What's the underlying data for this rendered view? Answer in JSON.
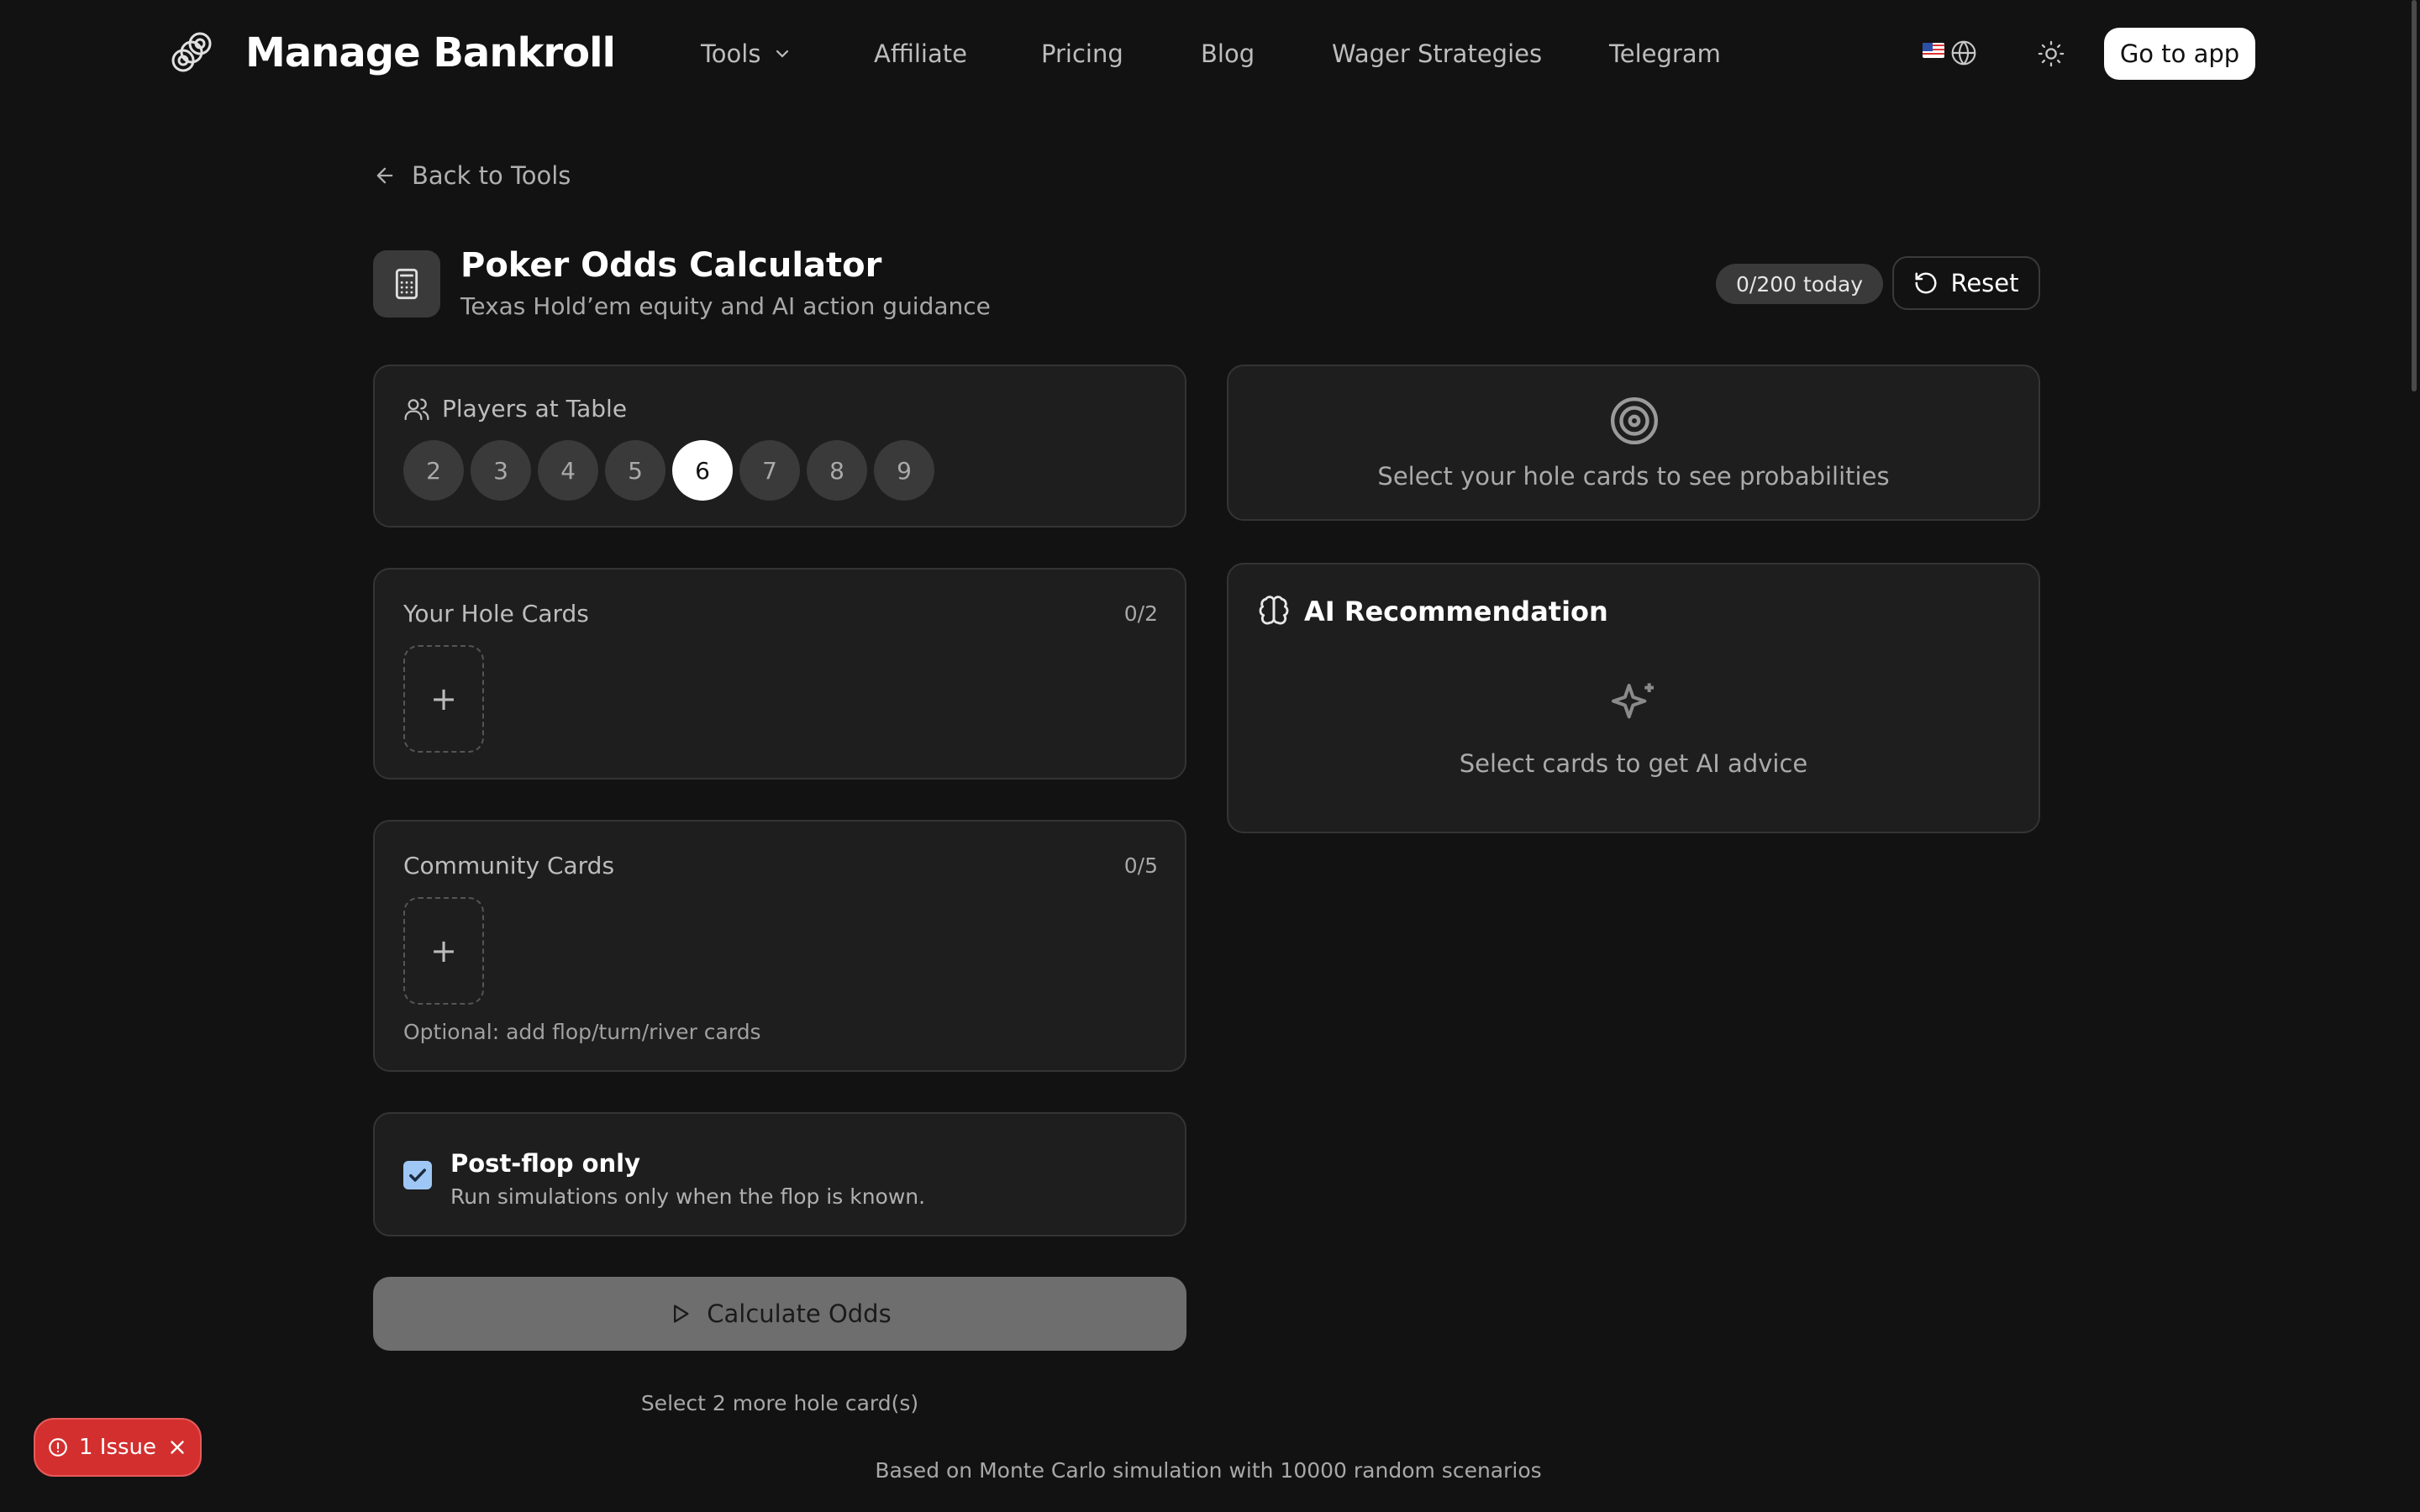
{
  "brand": {
    "name": "Manage Bankroll",
    "logo_icon": "chain-link-logo-icon"
  },
  "nav": {
    "items": [
      {
        "label": "Tools",
        "has_dropdown": true
      },
      {
        "label": "Affiliate"
      },
      {
        "label": "Pricing"
      },
      {
        "label": "Blog"
      },
      {
        "label": "Wager Strategies"
      },
      {
        "label": "Telegram"
      }
    ],
    "language_icon": "globe-icon",
    "theme_icon": "sun-icon",
    "cta_label": "Go to app"
  },
  "back_link": "Back to Tools",
  "tool": {
    "icon": "calculator-icon",
    "title": "Poker Odds Calculator",
    "subtitle": "Texas Hold’em equity and AI action guidance",
    "usage_badge": "0/200 today",
    "reset_label": "Reset"
  },
  "players": {
    "label": "Players at Table",
    "options": [
      "2",
      "3",
      "4",
      "5",
      "6",
      "7",
      "8",
      "9"
    ],
    "selected": "6"
  },
  "hole_cards": {
    "label": "Your Hole Cards",
    "count": "0/2",
    "add_symbol": "+"
  },
  "community_cards": {
    "label": "Community Cards",
    "count": "0/5",
    "add_symbol": "+",
    "hint": "Optional: add flop/turn/river cards"
  },
  "postflop": {
    "checked": true,
    "title": "Post-flop only",
    "description": "Run simulations only when the flop is known."
  },
  "calculate": {
    "label": "Calculate Odds",
    "hint": "Select 2 more hole card(s)"
  },
  "probabilities": {
    "icon": "target-icon",
    "empty_text": "Select your hole cards to see probabilities"
  },
  "ai": {
    "icon": "brain-icon",
    "title": "AI Recommendation",
    "empty_icon": "sparkles-icon",
    "empty_text": "Select cards to get AI advice"
  },
  "footer_note": "Based on Monte Carlo simulation with 10000 random scenarios",
  "issues_badge": {
    "label": "1 Issue"
  },
  "colors": {
    "background": "#121212",
    "panel": "#1e1e1e",
    "border": "#343434",
    "issue_red": "#d32f2f",
    "checkbox_blue": "#9fc7f5"
  }
}
